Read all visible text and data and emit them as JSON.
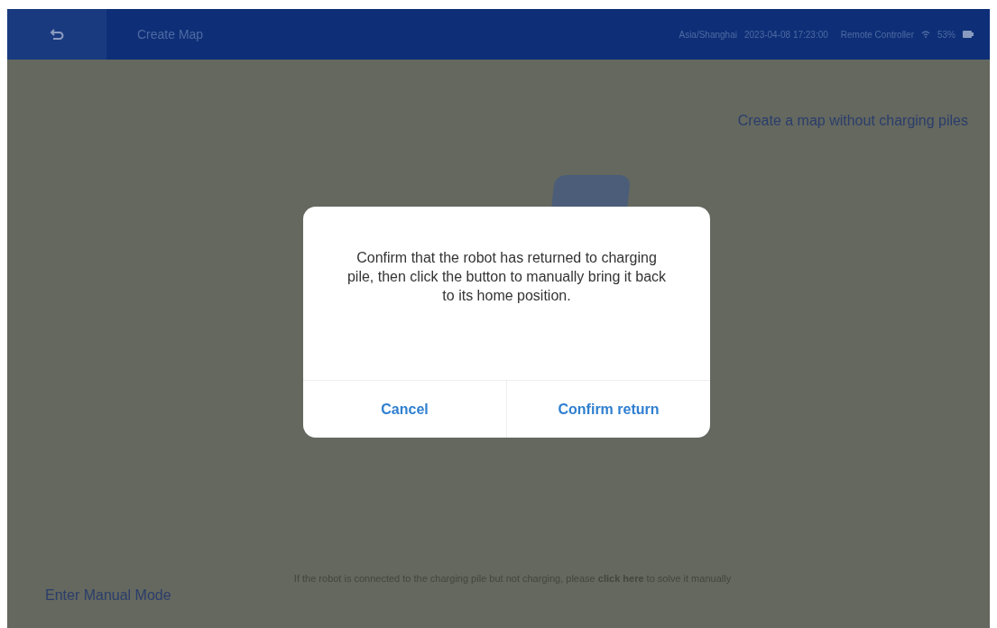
{
  "header": {
    "title": "Create Map",
    "timezone": "Asia/Shanghai",
    "datetime": "2023-04-08 17:23:00",
    "controller": "Remote Controller",
    "battery": "53%"
  },
  "link_top": "Create a map without charging piles",
  "manual_mode": "Enter Manual Mode",
  "hint": "If the robot is connected to the charging pile but not charging, please **click here** to solve it manually",
  "dialog": {
    "message": "Confirm that the robot has returned to charging pile, then click the button to manually bring it back to its home position.",
    "buttons": [
      {
        "label": "Cancel"
      },
      {
        "label": "Confirm return"
      }
    ]
  }
}
